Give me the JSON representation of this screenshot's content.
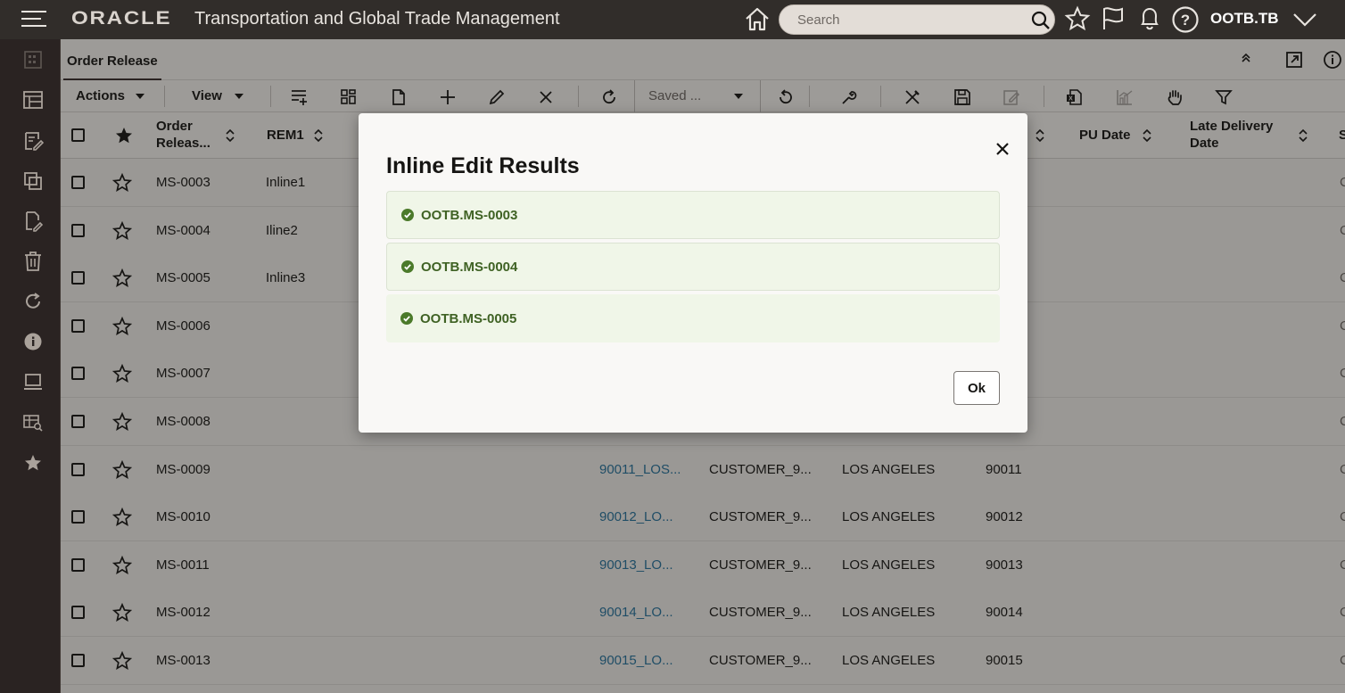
{
  "header": {
    "brand": "ORACLE",
    "app_title": "Transportation and Global Trade Management",
    "search_placeholder": "Search",
    "user": "OOTB.TB"
  },
  "tabs": {
    "active": "Order Release"
  },
  "toolbar": {
    "actions_label": "Actions",
    "view_label": "View",
    "saved_query_value": "Saved ..."
  },
  "table": {
    "columns": [
      {
        "label": "Order Releas..."
      },
      {
        "label": "REM1"
      },
      {
        "label": "PU Date"
      },
      {
        "label": "Late Delivery Date"
      }
    ],
    "col0_line1": "Order",
    "col0_line2": "Releas...",
    "col3_line1": "Late Delivery",
    "col3_line2": "Date",
    "rows": [
      {
        "id": "MS-0003",
        "rem1": "Inline1"
      },
      {
        "id": "MS-0004",
        "rem1": "Iline2"
      },
      {
        "id": "MS-0005",
        "rem1": "Inline3"
      },
      {
        "id": "MS-0006"
      },
      {
        "id": "MS-0007"
      },
      {
        "id": "MS-0008"
      },
      {
        "id": "MS-0009",
        "loc": "90011_LOS...",
        "customer": "CUSTOMER_9...",
        "city": "LOS ANGELES",
        "zip": "90011"
      },
      {
        "id": "MS-0010",
        "loc": "90012_LO...",
        "customer": "CUSTOMER_9...",
        "city": "LOS ANGELES",
        "zip": "90012"
      },
      {
        "id": "MS-0011",
        "loc": "90013_LO...",
        "customer": "CUSTOMER_9...",
        "city": "LOS ANGELES",
        "zip": "90013"
      },
      {
        "id": "MS-0012",
        "loc": "90014_LO...",
        "customer": "CUSTOMER_9...",
        "city": "LOS ANGELES",
        "zip": "90014"
      },
      {
        "id": "MS-0013",
        "loc": "90015_LO...",
        "customer": "CUSTOMER_9...",
        "city": "LOS ANGELES",
        "zip": "90015"
      }
    ]
  },
  "modal": {
    "title": "Inline Edit Results",
    "results": [
      {
        "label": "OOTB.MS-0003",
        "status": "success"
      },
      {
        "label": "OOTB.MS-0004",
        "status": "success"
      },
      {
        "label": "OOTB.MS-0005",
        "status": "success"
      }
    ],
    "ok_label": "Ok"
  },
  "colors": {
    "header_bg": "#312d2a",
    "success_text": "#3f6224",
    "success_icon": "#4b7a2a",
    "link": "#1f4d66"
  }
}
